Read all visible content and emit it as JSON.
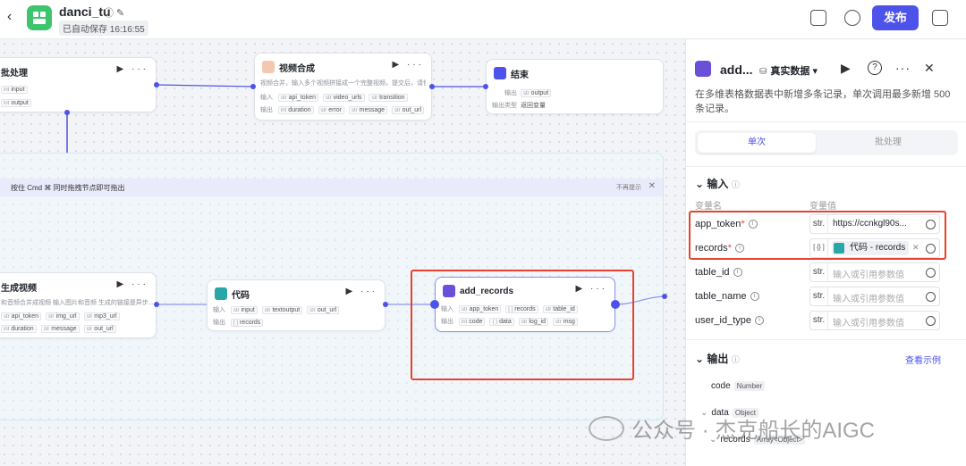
{
  "header": {
    "title": "danci_tu",
    "autosave": "已自动保存 16:16:55",
    "publish_label": "发布"
  },
  "canvas": {
    "batch_node": {
      "title": "批处理",
      "inputs": [
        {
          "type": "int",
          "name": "input"
        }
      ],
      "outputs": [
        {
          "type": "int",
          "name": "output"
        }
      ]
    },
    "video_node": {
      "title": "视频合成",
      "desc": "视频合并，输入多个视频拼接成一个完整视频，提交后，请使...",
      "input_label": "输入",
      "output_label": "输出",
      "inputs": [
        {
          "type": "str",
          "name": "api_token"
        },
        {
          "type": "str",
          "name": "video_urls"
        },
        {
          "type": "str",
          "name": "transition"
        }
      ],
      "outputs": [
        {
          "type": "int",
          "name": "duration"
        },
        {
          "type": "str",
          "name": "error"
        },
        {
          "type": "str",
          "name": "message"
        },
        {
          "type": "str",
          "name": "out_url"
        }
      ]
    },
    "end_node": {
      "title": "结束",
      "output_label": "输出",
      "output_var": "output",
      "output_type_label": "输出类型",
      "output_type_value": "返回变量"
    },
    "banner": {
      "text": "按住 Cmd ⌘ 同时拖拽节点即可拖出",
      "dismiss": "不再提示"
    },
    "gen_node": {
      "title": "生成视频",
      "desc": "和音频合并成视频 输入图片和音频 生成的链接是异步...",
      "inputs": [
        {
          "type": "str",
          "name": "api_token"
        },
        {
          "type": "str",
          "name": "img_url"
        },
        {
          "type": "str",
          "name": "mp3_url"
        }
      ],
      "outputs": [
        {
          "type": "int",
          "name": "duration"
        },
        {
          "type": "str",
          "name": "message"
        },
        {
          "type": "str",
          "name": "out_url"
        }
      ]
    },
    "code_node": {
      "title": "代码",
      "input_label": "输入",
      "output_label": "输出",
      "inputs": [
        {
          "type": "str",
          "name": "input"
        },
        {
          "type": "str",
          "name": "textoutput"
        },
        {
          "type": "str",
          "name": "out_url"
        }
      ],
      "outputs": [
        {
          "type": "[ ]",
          "name": "records"
        }
      ]
    },
    "add_node": {
      "title": "add_records",
      "input_label": "输入",
      "output_label": "输出",
      "inputs": [
        {
          "type": "str",
          "name": "app_token"
        },
        {
          "type": "[ ]",
          "name": "records"
        },
        {
          "type": "str",
          "name": "table_id"
        }
      ],
      "outputs": [
        {
          "type": "int",
          "name": "code"
        },
        {
          "type": "{ }",
          "name": "data"
        },
        {
          "type": "str",
          "name": "log_id"
        },
        {
          "type": "str",
          "name": "msg"
        }
      ]
    }
  },
  "panel": {
    "title": "add...",
    "mode": "真实数据",
    "description": "在多维表格数据表中新增多条记录，单次调用最多新增 500 条记录。",
    "tabs": [
      "单次",
      "批处理"
    ],
    "input_section": "输入",
    "col_name": "变量名",
    "col_value": "变量值",
    "params": [
      {
        "name": "app_token",
        "required": true,
        "type": "str.",
        "value": "https://ccnkgl90s..."
      },
      {
        "name": "records",
        "required": true,
        "type": "[ {} ]",
        "chip": "代码 - records"
      },
      {
        "name": "table_id",
        "required": false,
        "type": "str.",
        "placeholder": "输入或引用参数值"
      },
      {
        "name": "table_name",
        "required": false,
        "type": "str.",
        "placeholder": "输入或引用参数值"
      },
      {
        "name": "user_id_type",
        "required": false,
        "type": "str.",
        "placeholder": "输入或引用参数值"
      }
    ],
    "output_section": "输出",
    "example_link": "查看示例",
    "outputs": [
      {
        "name": "code",
        "type": "Number"
      },
      {
        "name": "data",
        "type": "Object"
      },
      {
        "name": "records",
        "type": "Array<Object>"
      }
    ]
  },
  "watermark": "公众号 · 杰克船长的AIGC",
  "colors": {
    "accent": "#4d53e8",
    "highlight": "#e5432f",
    "code": "#29a6a6",
    "brand": "#3ec46d"
  }
}
